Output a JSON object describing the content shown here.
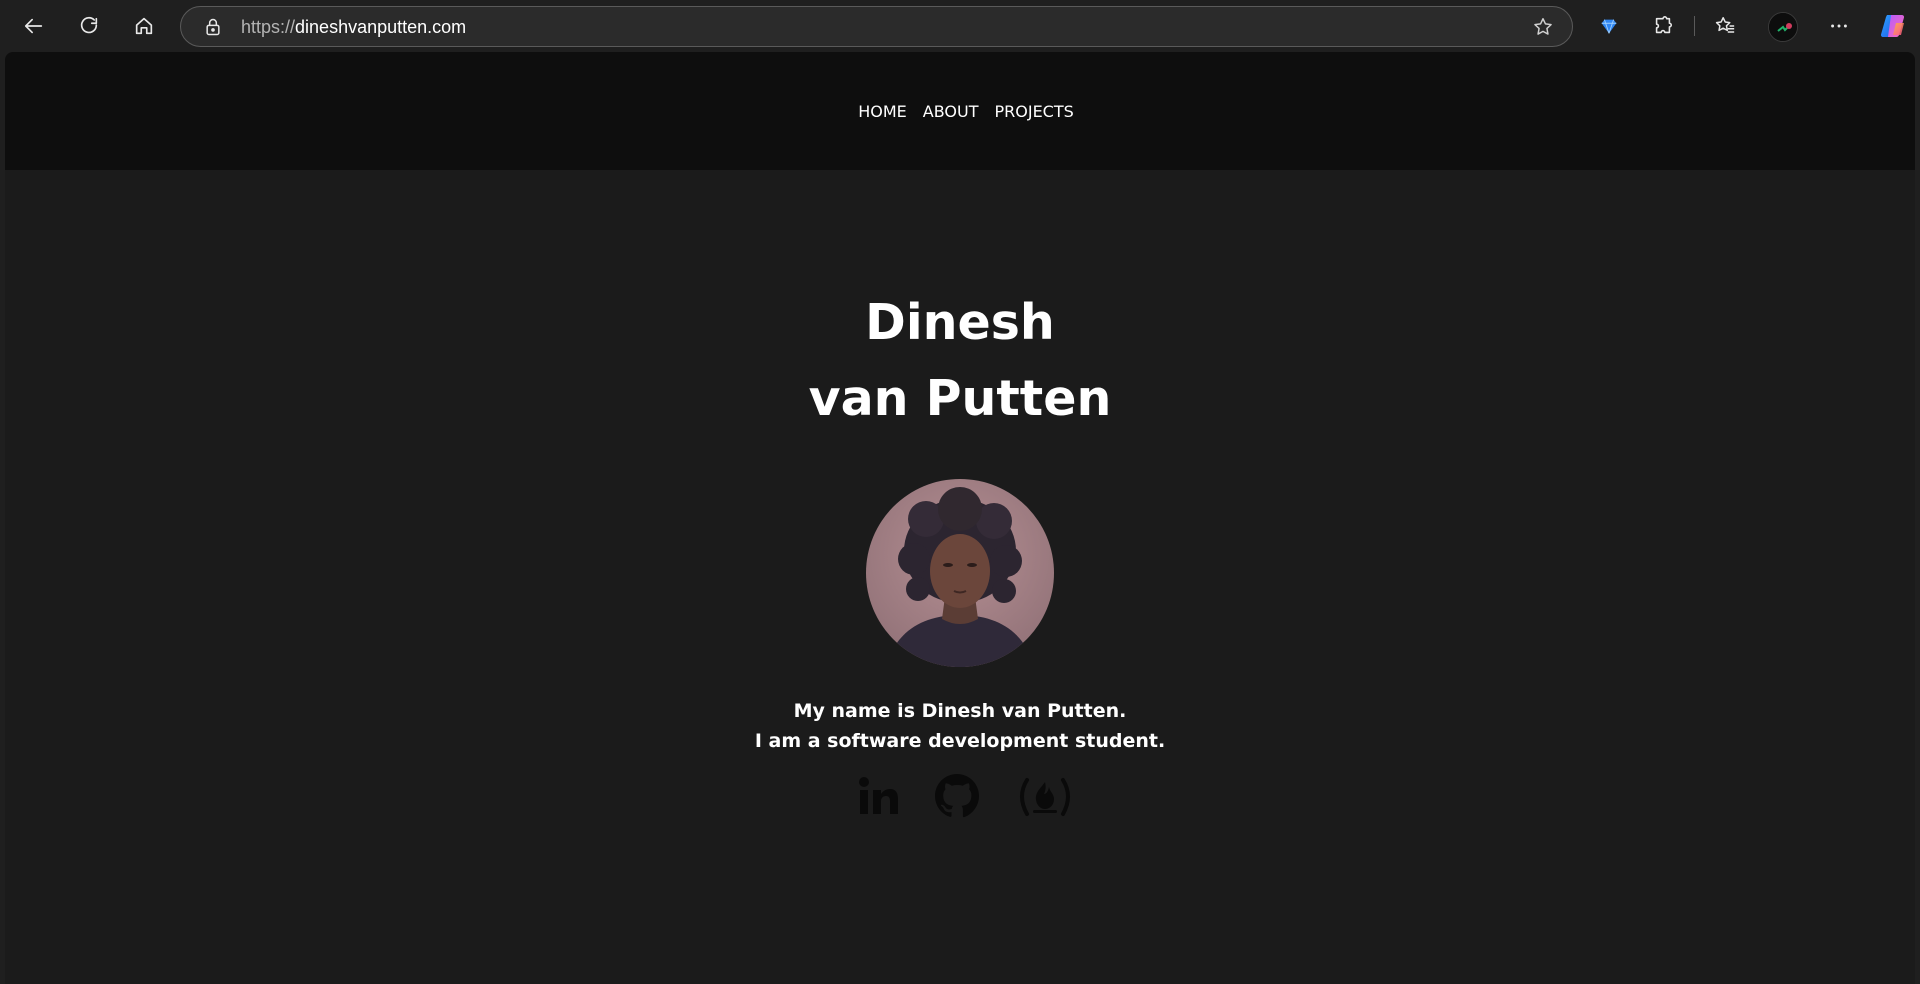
{
  "browser": {
    "url_scheme": "https://",
    "url_host": "dineshvanputten.com",
    "icons": [
      "back-icon",
      "reload-icon",
      "home-icon",
      "lock-icon",
      "star-icon",
      "extension-gem-icon",
      "puzzle-icon",
      "favorites-icon",
      "profile-avatar",
      "more-icon",
      "copilot-icon"
    ]
  },
  "site": {
    "nav": [
      {
        "label": "HOME"
      },
      {
        "label": "ABOUT"
      },
      {
        "label": "PROJECTS"
      }
    ],
    "hero": {
      "name_line1": "Dinesh",
      "name_line2": "van Putten"
    },
    "bio": {
      "line1": "My name is Dinesh van Putten.",
      "line2": "I am a software development student."
    },
    "social": [
      {
        "icon": "linkedin-icon"
      },
      {
        "icon": "github-icon"
      },
      {
        "icon": "freecodecamp-icon"
      }
    ]
  },
  "colors": {
    "header_bg": "#0e0e0e",
    "page_bg": "#1b1b1b",
    "text": "#ffffff",
    "social_icon": "#0a0a0a"
  }
}
